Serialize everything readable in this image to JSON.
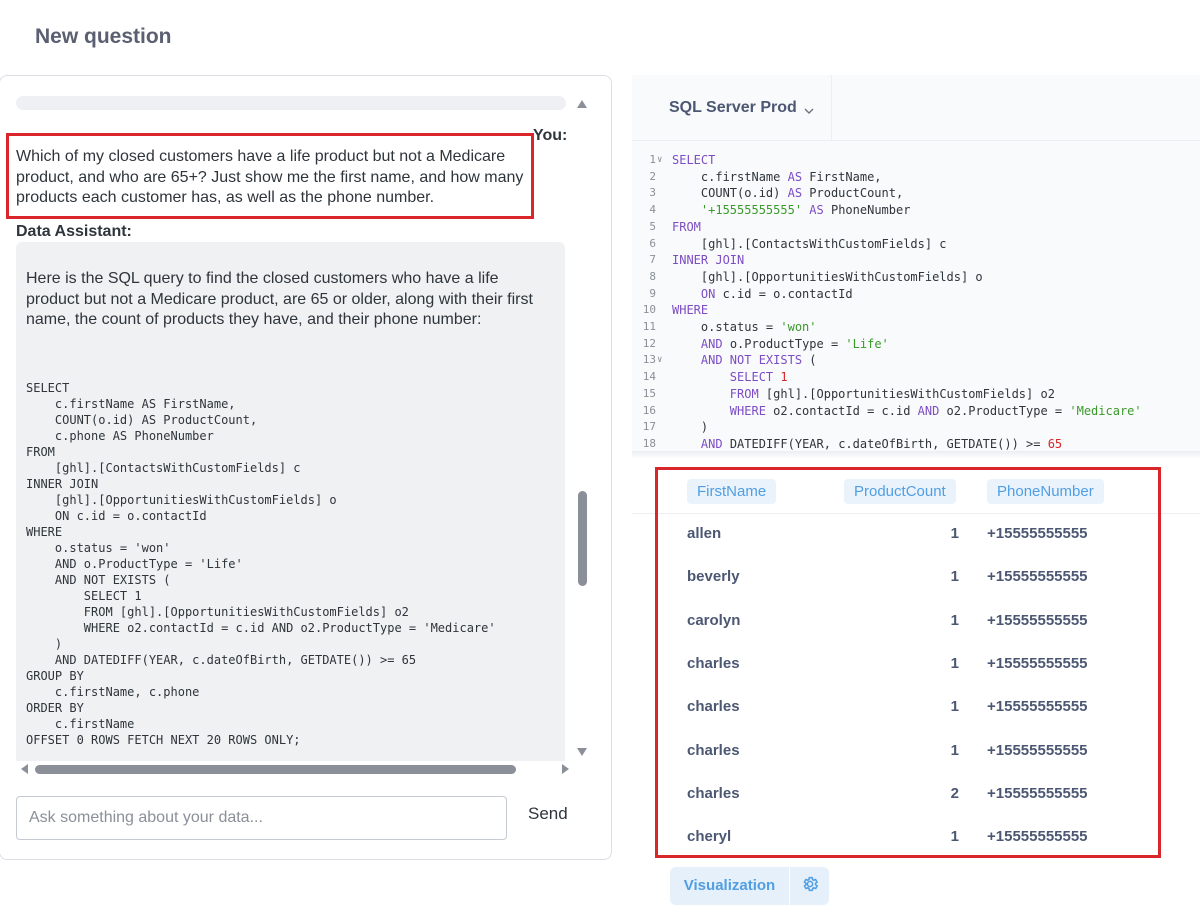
{
  "page": {
    "title": "New question"
  },
  "chat": {
    "you_label": "You:",
    "user_message": "Which of my closed customers have a life product but not a Medicare product, and who are 65+? Just show me the first name, and how many products each customer has, as well as the phone number.",
    "assistant_label": "Data Assistant:",
    "assistant_message": "Here is the SQL query to find the closed customers who have a life product but not a Medicare product, are 65 or older, along with their first name, the count of products they have, and their phone number:",
    "assistant_sql": "SELECT\n    c.firstName AS FirstName,\n    COUNT(o.id) AS ProductCount,\n    c.phone AS PhoneNumber\nFROM\n    [ghl].[ContactsWithCustomFields] c\nINNER JOIN\n    [ghl].[OpportunitiesWithCustomFields] o\n    ON c.id = o.contactId\nWHERE\n    o.status = 'won'\n    AND o.ProductType = 'Life'\n    AND NOT EXISTS (\n        SELECT 1\n        FROM [ghl].[OpportunitiesWithCustomFields] o2\n        WHERE o2.contactId = c.id AND o2.ProductType = 'Medicare'\n    )\n    AND DATEDIFF(YEAR, c.dateOfBirth, GETDATE()) >= 65\nGROUP BY\n    c.firstName, c.phone\nORDER BY\n    c.firstName\nOFFSET 0 ROWS FETCH NEXT 20 ROWS ONLY;",
    "input_placeholder": "Ask something about your data...",
    "send_label": "Send"
  },
  "editor": {
    "database": "SQL Server Prod",
    "lines": [
      {
        "n": "1",
        "fold": true,
        "html": "<span class=\"kw\">SELECT</span>"
      },
      {
        "n": "2",
        "html": "    c.firstName <span class=\"kw\">AS</span> FirstName,"
      },
      {
        "n": "3",
        "html": "    COUNT(o.id) <span class=\"kw\">AS</span> ProductCount,"
      },
      {
        "n": "4",
        "html": "    <span class=\"str\">'+15555555555'</span> <span class=\"kw\">AS</span> PhoneNumber"
      },
      {
        "n": "5",
        "html": "<span class=\"kw\">FROM</span>"
      },
      {
        "n": "6",
        "html": "    [ghl].[ContactsWithCustomFields] c"
      },
      {
        "n": "7",
        "html": "<span class=\"kw\">INNER JOIN</span>"
      },
      {
        "n": "8",
        "html": "    [ghl].[OpportunitiesWithCustomFields] o"
      },
      {
        "n": "9",
        "html": "    <span class=\"kw\">ON</span> c.id = o.contactId"
      },
      {
        "n": "10",
        "html": "<span class=\"kw\">WHERE</span>"
      },
      {
        "n": "11",
        "html": "    o.status = <span class=\"str\">'won'</span>"
      },
      {
        "n": "12",
        "html": "    <span class=\"kw\">AND</span> o.ProductType = <span class=\"str\">'Life'</span>"
      },
      {
        "n": "13",
        "fold": true,
        "html": "    <span class=\"kw\">AND NOT EXISTS</span> ("
      },
      {
        "n": "14",
        "html": "        <span class=\"kw\">SELECT</span> <span class=\"num\">1</span>"
      },
      {
        "n": "15",
        "html": "        <span class=\"kw\">FROM</span> [ghl].[OpportunitiesWithCustomFields] o2"
      },
      {
        "n": "16",
        "html": "        <span class=\"kw\">WHERE</span> o2.contactId = c.id <span class=\"kw\">AND</span> o2.ProductType = <span class=\"str\">'Medicare'</span>"
      },
      {
        "n": "17",
        "html": "    )"
      },
      {
        "n": "18",
        "html": "    <span class=\"kw\">AND</span> DATEDIFF(YEAR, c.dateOfBirth, GETDATE()) >= <span class=\"num\">65</span>"
      }
    ]
  },
  "results": {
    "columns": [
      "FirstName",
      "ProductCount",
      "PhoneNumber"
    ],
    "rows": [
      {
        "first_name": "allen",
        "product_count": "1",
        "phone": "+15555555555"
      },
      {
        "first_name": "beverly",
        "product_count": "1",
        "phone": "+15555555555"
      },
      {
        "first_name": "carolyn",
        "product_count": "1",
        "phone": "+15555555555"
      },
      {
        "first_name": "charles",
        "product_count": "1",
        "phone": "+15555555555"
      },
      {
        "first_name": "charles",
        "product_count": "1",
        "phone": "+15555555555"
      },
      {
        "first_name": "charles",
        "product_count": "1",
        "phone": "+15555555555"
      },
      {
        "first_name": "charles",
        "product_count": "2",
        "phone": "+15555555555"
      },
      {
        "first_name": "cheryl",
        "product_count": "1",
        "phone": "+15555555555"
      }
    ]
  },
  "footer": {
    "visualization_label": "Visualization"
  },
  "colors": {
    "accent": "#509ee3",
    "highlight": "#d9262a",
    "keyword": "#7c4dc4",
    "string": "#3a9a2b"
  }
}
